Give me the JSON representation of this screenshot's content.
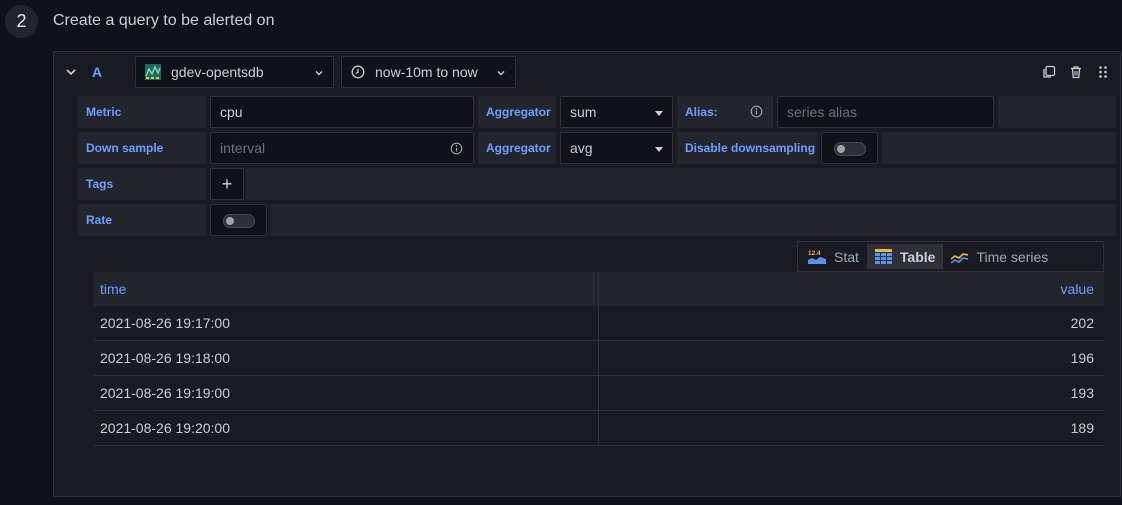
{
  "step": {
    "number": "2",
    "title": "Create a query to be alerted on"
  },
  "query": {
    "ref_id": "A",
    "datasource": "gdev-opentsdb",
    "time_range": "now-10m to now"
  },
  "form": {
    "metric_label": "Metric",
    "metric_value": "cpu",
    "aggregator_label": "Aggregator",
    "aggregator_value": "sum",
    "alias_label": "Alias:",
    "alias_placeholder": "series alias",
    "downsample_label": "Down sample",
    "downsample_placeholder": "interval",
    "downsample_aggregator_label": "Aggregator",
    "downsample_aggregator_value": "avg",
    "disable_downsampling_label": "Disable downsampling",
    "disable_downsampling": false,
    "tags_label": "Tags",
    "tags_add": "+",
    "rate_label": "Rate",
    "rate": false
  },
  "view_switch": {
    "options": [
      {
        "label": "Stat",
        "icon": "stat-icon",
        "badge": "12.4"
      },
      {
        "label": "Table",
        "icon": "table-icon"
      },
      {
        "label": "Time series",
        "icon": "timeseries-icon"
      }
    ],
    "selected": "Table"
  },
  "table": {
    "columns": [
      "time",
      "value"
    ],
    "rows": [
      [
        "2021-08-26 19:17:00",
        "202"
      ],
      [
        "2021-08-26 19:18:00",
        "196"
      ],
      [
        "2021-08-26 19:19:00",
        "193"
      ],
      [
        "2021-08-26 19:20:00",
        "189"
      ]
    ]
  },
  "colors": {
    "background": "#111217",
    "panel": "#181b1f",
    "accent": "#6e9fff"
  }
}
